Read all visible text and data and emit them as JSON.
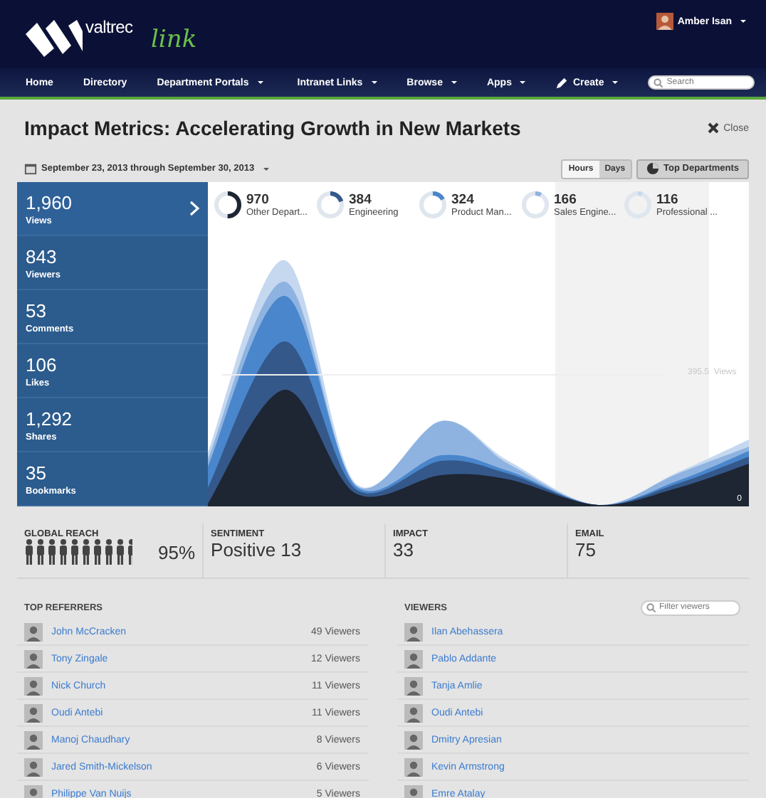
{
  "brand": {
    "word": "valtrec",
    "script": "link"
  },
  "user": {
    "name": "Amber Isan"
  },
  "nav": [
    {
      "kind": "link",
      "label": "Home",
      "has_menu": false
    },
    {
      "kind": "link",
      "label": "Directory",
      "has_menu": false
    },
    {
      "kind": "link",
      "label": "Department Portals",
      "has_menu": true
    },
    {
      "kind": "link",
      "label": "Intranet Links",
      "has_menu": true
    },
    {
      "kind": "link",
      "label": "Browse",
      "has_menu": true
    },
    {
      "kind": "link",
      "label": "Apps",
      "has_menu": true
    },
    {
      "kind": "create",
      "label": "Create",
      "has_menu": true
    }
  ],
  "search": {
    "placeholder": "Search"
  },
  "title": "Impact Metrics: Accelerating Growth in New Markets",
  "close": "Close",
  "date_range": "September 23, 2013 through September 30, 2013",
  "granularity": [
    {
      "label": "Hours",
      "selected": true
    },
    {
      "label": "Days",
      "selected": false
    }
  ],
  "top_departments": "Top Departments",
  "stats": [
    {
      "value": "1,960",
      "label": "Views",
      "selected": true
    },
    {
      "value": "843",
      "label": "Viewers",
      "selected": false
    },
    {
      "value": "53",
      "label": "Comments",
      "selected": false
    },
    {
      "value": "106",
      "label": "Likes",
      "selected": false
    },
    {
      "value": "1,292",
      "label": "Shares",
      "selected": false
    },
    {
      "value": "35",
      "label": "Bookmarks",
      "selected": false
    }
  ],
  "departments": [
    {
      "value": "970",
      "label": "Other Depart...",
      "color": "#1e2533"
    },
    {
      "value": "384",
      "label": "Engineering",
      "color": "#34588a"
    },
    {
      "value": "324",
      "label": "Product Man...",
      "color": "#4a86cc"
    },
    {
      "value": "166",
      "label": "Sales Engine...",
      "color": "#8fb3e0"
    },
    {
      "value": "116",
      "label": "Professional ...",
      "color": "#c5d8f0"
    }
  ],
  "chart": {
    "reference": "395.5  Views",
    "baseline": "0"
  },
  "metrics": [
    {
      "kind": "people",
      "label": "GLOBAL REACH",
      "value": "95%",
      "level": 0.95
    },
    {
      "kind": "plain",
      "label": "SENTIMENT",
      "value": "Positive 13"
    },
    {
      "kind": "plain",
      "label": "IMPACT",
      "value": "33"
    },
    {
      "kind": "plain",
      "label": "EMAIL",
      "value": "75"
    }
  ],
  "referrers": {
    "heading": "TOP REFERRERS",
    "rows": [
      {
        "name": "John McCracken",
        "count": "49 Viewers"
      },
      {
        "name": "Tony Zingale",
        "count": "12 Viewers"
      },
      {
        "name": "Nick Church",
        "count": "11 Viewers"
      },
      {
        "name": "Oudi Antebi",
        "count": "11 Viewers"
      },
      {
        "name": "Manoj Chaudhary",
        "count": "8 Viewers"
      },
      {
        "name": "Jared Smith-Mickelson",
        "count": "6 Viewers"
      },
      {
        "name": "Philippe Van Nuijs",
        "count": "5 Viewers"
      }
    ]
  },
  "viewers": {
    "heading": "VIEWERS",
    "filter_placeholder": "Filter viewers",
    "rows": [
      {
        "name": "Ilan Abehassera"
      },
      {
        "name": "Pablo Addante"
      },
      {
        "name": "Tanja Amlie"
      },
      {
        "name": "Oudi Antebi"
      },
      {
        "name": "Dmitry Apresian"
      },
      {
        "name": "Kevin Armstrong"
      },
      {
        "name": "Emre Atalay"
      }
    ]
  }
}
